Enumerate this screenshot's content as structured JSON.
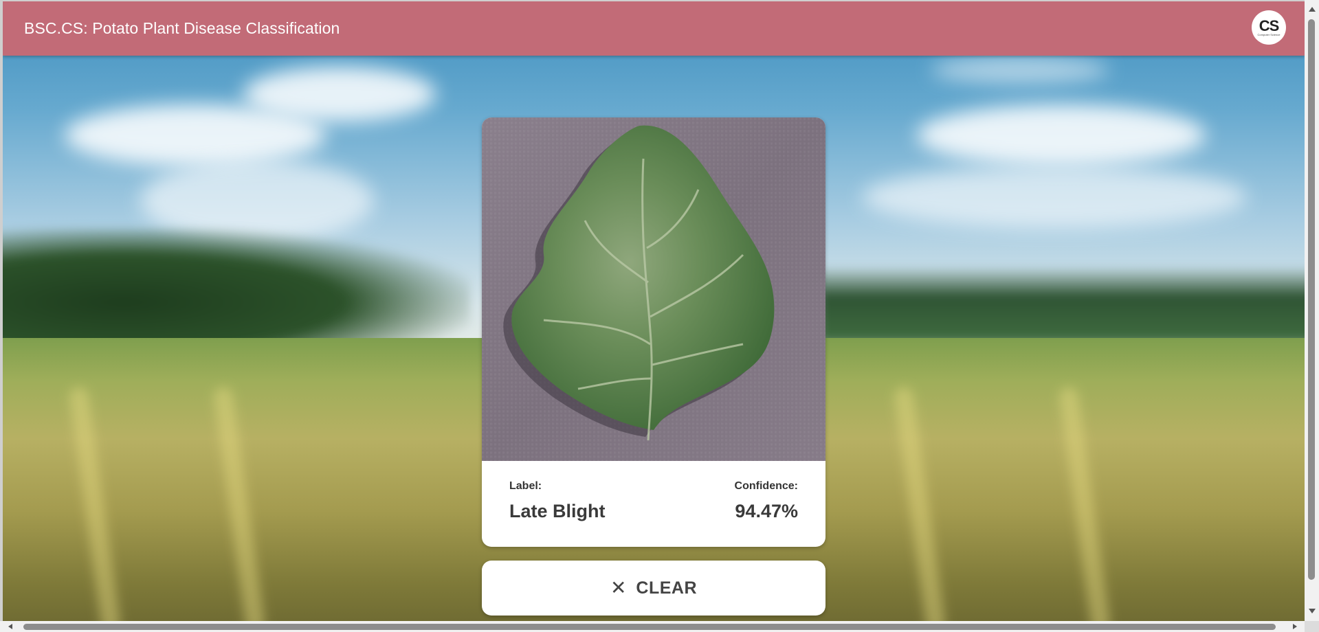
{
  "app": {
    "title": "BSC.CS: Potato Plant Disease Classification",
    "logo_text": "CS",
    "brand_color": "#c26b77"
  },
  "result": {
    "label_caption": "Label:",
    "label_value": "Late Blight",
    "confidence_caption": "Confidence:",
    "confidence_value": "94.47%"
  },
  "actions": {
    "clear_label": "CLEAR",
    "clear_icon": "close-icon"
  },
  "images": {
    "leaf_photo": "potato-leaf-image",
    "background": "field-landscape-background"
  }
}
